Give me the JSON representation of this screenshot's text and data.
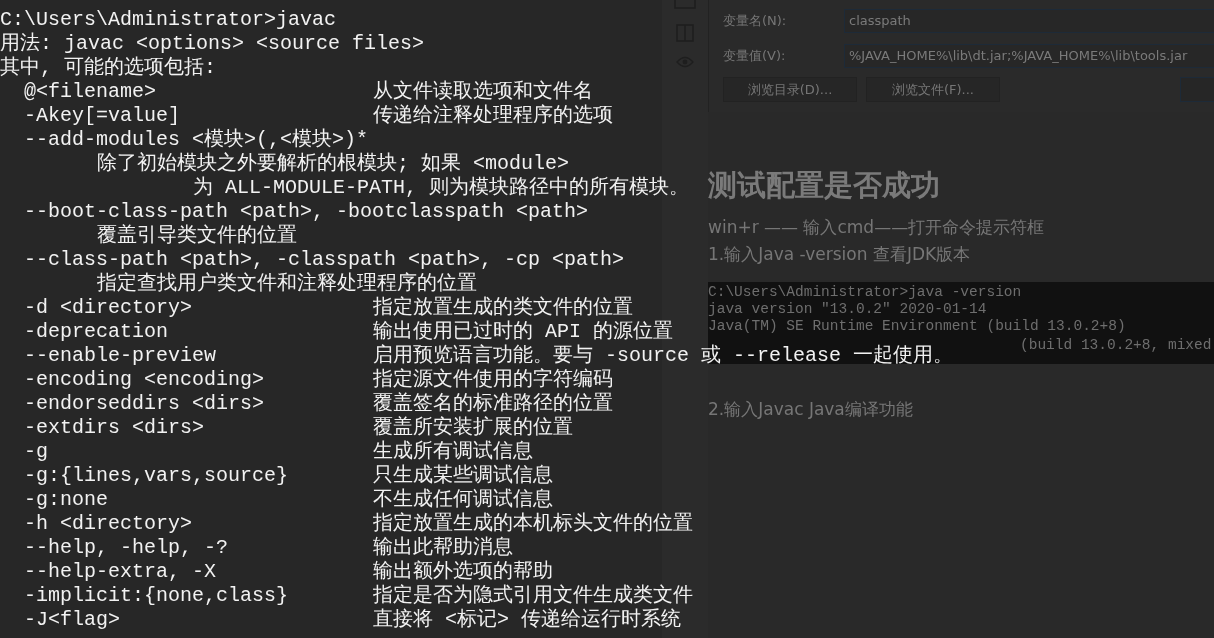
{
  "background_page": {
    "dialog": {
      "fields": [
        {
          "label": "变量名(N):",
          "value": "classpath"
        },
        {
          "label": "变量值(V):",
          "value": "%JAVA_HOME%\\lib\\dt.jar;%JAVA_HOME%\\lib\\tools.jar"
        }
      ],
      "buttons": [
        "浏览目录(D)...",
        "浏览文件(F)..."
      ]
    },
    "heading": "测试配置是否成功",
    "paragraphs": [
      "win+r —— 输入cmd——打开命令提示符框",
      "1.输入Java -version 查看JDK版本"
    ],
    "code_lines": [
      "C:\\Users\\Administrator>java -version",
      "java version \"13.0.2\" 2020-01-14",
      "Java(TM) SE Runtime Environment (build 13.0.2+8)"
    ],
    "code_tail": "(build 13.0.2+8, mixed",
    "paragraph_after": "2.输入Javac Java编译功能"
  },
  "terminal": {
    "lines": [
      {
        "kind": "text",
        "text": "C:\\Users\\Administrator>javac"
      },
      {
        "kind": "text",
        "text": "用法: javac <options> <source files>"
      },
      {
        "kind": "text",
        "text": "其中, 可能的选项包括:"
      },
      {
        "kind": "option",
        "option": "@<filename>",
        "description": "从文件读取选项和文件名"
      },
      {
        "kind": "option",
        "option": "-Akey[=value]",
        "description": "传递给注释处理程序的选项"
      },
      {
        "kind": "option",
        "option": "--add-modules <模块>(,<模块>)*"
      },
      {
        "kind": "detail",
        "text": "除了初始模块之外要解析的根模块; 如果 <module>"
      },
      {
        "kind": "wrap",
        "text": "为 ALL-MODULE-PATH, 则为模块路径中的所有模块。"
      },
      {
        "kind": "option",
        "option": "--boot-class-path <path>, -bootclasspath <path>"
      },
      {
        "kind": "detail",
        "text": "覆盖引导类文件的位置"
      },
      {
        "kind": "option",
        "option": "--class-path <path>, -classpath <path>, -cp <path>"
      },
      {
        "kind": "detail",
        "text": "指定查找用户类文件和注释处理程序的位置"
      },
      {
        "kind": "option",
        "option": "-d <directory>",
        "description": "指定放置生成的类文件的位置"
      },
      {
        "kind": "option",
        "option": "-deprecation",
        "description": "输出使用已过时的 API 的源位置"
      },
      {
        "kind": "option",
        "option": "--enable-preview",
        "description": "启用预览语言功能。要与 -source 或 --release 一起使用。"
      },
      {
        "kind": "option",
        "option": "-encoding <encoding>",
        "description": "指定源文件使用的字符编码"
      },
      {
        "kind": "option",
        "option": "-endorseddirs <dirs>",
        "description": "覆盖签名的标准路径的位置"
      },
      {
        "kind": "option",
        "option": "-extdirs <dirs>",
        "description": "覆盖所安装扩展的位置"
      },
      {
        "kind": "option",
        "option": "-g",
        "description": "生成所有调试信息"
      },
      {
        "kind": "option",
        "option": "-g:{lines,vars,source}",
        "description": "只生成某些调试信息"
      },
      {
        "kind": "option",
        "option": "-g:none",
        "description": "不生成任何调试信息"
      },
      {
        "kind": "option",
        "option": "-h <directory>",
        "description": "指定放置生成的本机标头文件的位置"
      },
      {
        "kind": "option",
        "option": "--help, -help, -?",
        "description": "输出此帮助消息"
      },
      {
        "kind": "option",
        "option": "--help-extra, -X",
        "description": "输出额外选项的帮助"
      },
      {
        "kind": "option",
        "option": "-implicit:{none,class}",
        "description": "指定是否为隐式引用文件生成类文件"
      },
      {
        "kind": "option",
        "option": "-J<flag>",
        "description": "直接将 <标记> 传递给运行时系统"
      }
    ]
  }
}
